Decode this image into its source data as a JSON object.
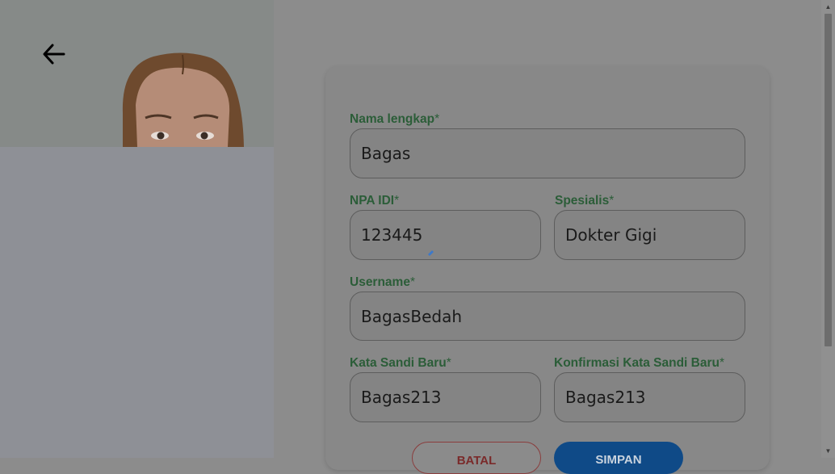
{
  "form": {
    "full_name": {
      "label": "Nama lengkap",
      "required": "*",
      "value": "Bagas"
    },
    "npa_idi": {
      "label": "NPA IDI",
      "required": "*",
      "value": "123445"
    },
    "specialist": {
      "label": "Spesialis",
      "required": "*",
      "value": "Dokter Gigi"
    },
    "username": {
      "label": "Username",
      "required": "*",
      "value": "BagasBedah"
    },
    "new_password": {
      "label": "Kata Sandi Baru",
      "required": "*",
      "value": "Bagas213"
    },
    "confirm_password": {
      "label": "Konfirmasi Kata Sandi Baru",
      "required": "*",
      "value": "Bagas213"
    }
  },
  "buttons": {
    "back": "BATAL",
    "save": "SIMPAN"
  },
  "icons": {
    "back": "arrow-left-icon",
    "scroll_up": "triangle-up-icon",
    "scroll_down": "triangle-down-icon"
  },
  "colors": {
    "label": "#2b5d38",
    "save_button": "#0f4a87",
    "back_button_border": "#8a3d3d"
  }
}
